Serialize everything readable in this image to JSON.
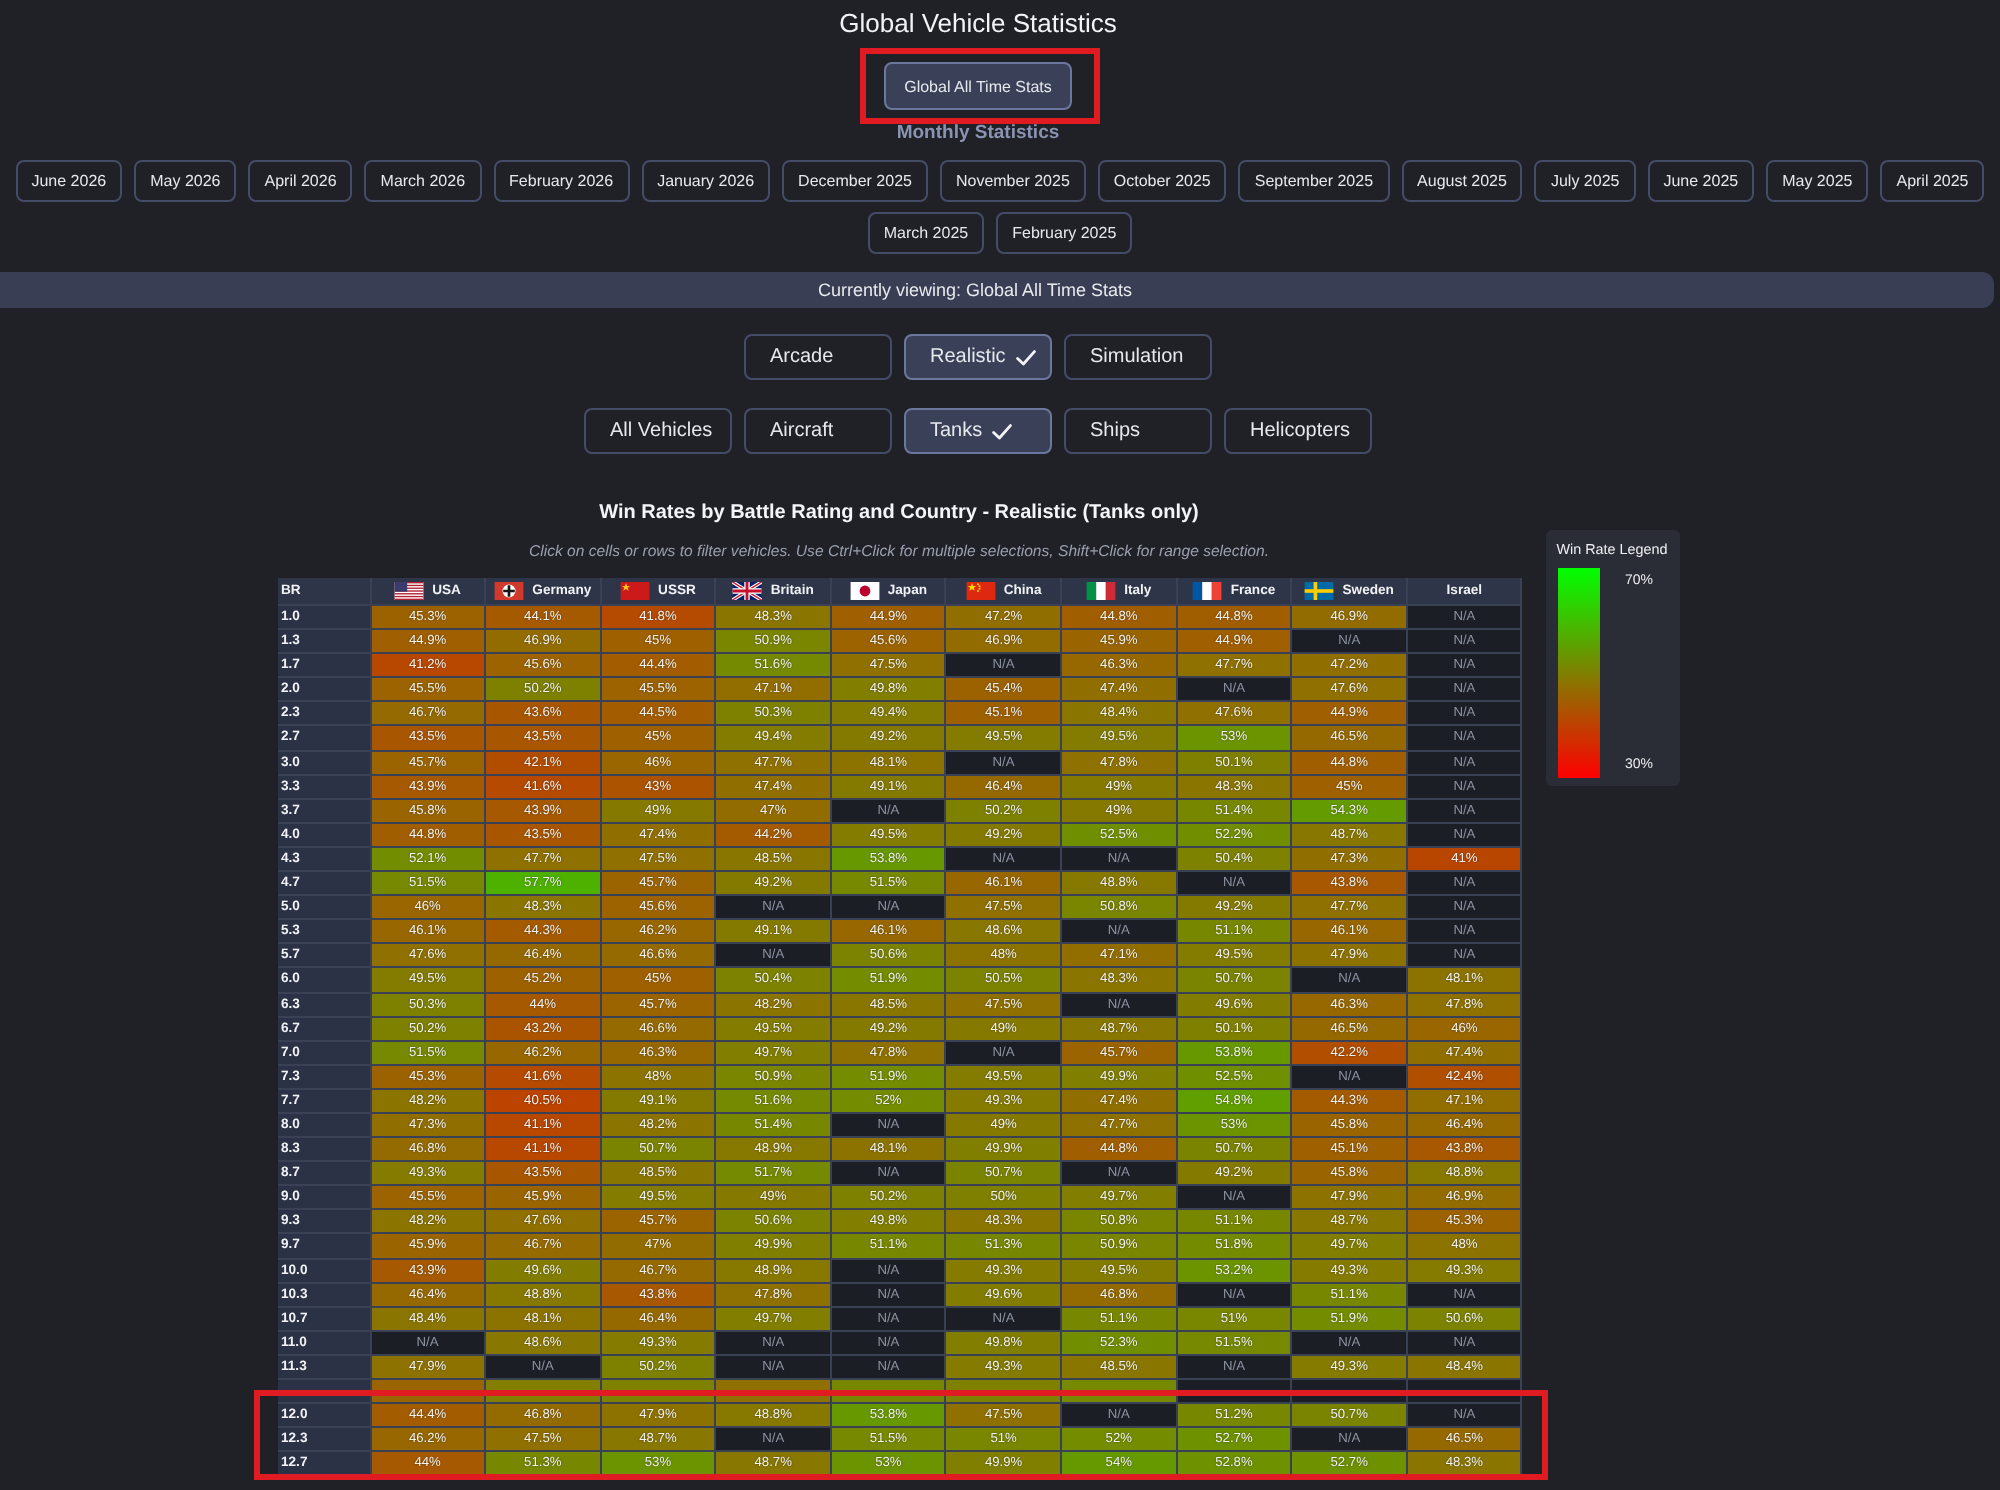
{
  "page": {
    "title": "Global Vehicle Statistics"
  },
  "all_time_button": {
    "label": "Global All Time Stats",
    "selected": true,
    "highlighted": true
  },
  "monthly": {
    "heading": "Monthly Statistics",
    "months": [
      {
        "label": "June 2026",
        "selected": false
      },
      {
        "label": "May 2026",
        "selected": false
      },
      {
        "label": "April 2026",
        "selected": false
      },
      {
        "label": "March 2026",
        "selected": false
      },
      {
        "label": "February 2026",
        "selected": false
      },
      {
        "label": "January 2026",
        "selected": false
      },
      {
        "label": "December 2025",
        "selected": false
      },
      {
        "label": "November 2025",
        "selected": false
      },
      {
        "label": "October 2025",
        "selected": false
      },
      {
        "label": "September 2025",
        "selected": false
      },
      {
        "label": "August 2025",
        "selected": false
      },
      {
        "label": "July 2025",
        "selected": false
      },
      {
        "label": "June 2025",
        "selected": false
      },
      {
        "label": "May 2025",
        "selected": false
      },
      {
        "label": "April 2025",
        "selected": false
      },
      {
        "label": "March 2025",
        "selected": false
      },
      {
        "label": "February 2025",
        "selected": false
      }
    ]
  },
  "status_bar": {
    "text": "Currently viewing: Global All Time Stats"
  },
  "modes": [
    {
      "label": "Arcade",
      "selected": false
    },
    {
      "label": "Realistic",
      "selected": true
    },
    {
      "label": "Simulation",
      "selected": false
    }
  ],
  "categories": [
    {
      "label": "All Vehicles",
      "selected": false
    },
    {
      "label": "Aircraft",
      "selected": false
    },
    {
      "label": "Tanks",
      "selected": true
    },
    {
      "label": "Ships",
      "selected": false
    },
    {
      "label": "Helicopters",
      "selected": false
    }
  ],
  "heatmap": {
    "title": "Win Rates by Battle Rating and Country - Realistic (Tanks only)",
    "hint": "Click on cells or rows to filter vehicles. Use Ctrl+Click for multiple selections, Shift+Click for range selection.",
    "corner_label": "BR",
    "columns": [
      {
        "label": "USA",
        "kind": "us"
      },
      {
        "label": "Germany",
        "kind": "germany"
      },
      {
        "label": "USSR",
        "kind": "ussr"
      },
      {
        "label": "Britain",
        "kind": "uk"
      },
      {
        "label": "Japan",
        "kind": "japan"
      },
      {
        "label": "China",
        "kind": "china"
      },
      {
        "label": "Italy",
        "kind": "italy"
      },
      {
        "label": "France",
        "kind": "france"
      },
      {
        "label": "Sweden",
        "kind": "sweden"
      },
      {
        "label": "Israel",
        "kind": "plain"
      }
    ],
    "rows": [
      {
        "br": "1.0",
        "highlighted": false,
        "cells": [
          {
            "value": "45.3%",
            "color": "#9d6200"
          },
          {
            "value": "44.1%",
            "color": "#a55a00"
          },
          {
            "value": "41.8%",
            "color": "#b44b00"
          },
          {
            "value": "48.3%",
            "color": "#8a7500"
          },
          {
            "value": "44.9%",
            "color": "#a05f00"
          },
          {
            "value": "47.2%",
            "color": "#916e00"
          },
          {
            "value": "44.8%",
            "color": "#a15e00"
          },
          {
            "value": "44.8%",
            "color": "#a15e00"
          },
          {
            "value": "46.9%",
            "color": "#936c00"
          },
          {
            "value": "N/A"
          }
        ]
      },
      {
        "br": "1.3",
        "highlighted": false,
        "cells": [
          {
            "value": "44.9%",
            "color": "#a05f00"
          },
          {
            "value": "46.9%",
            "color": "#936c00"
          },
          {
            "value": "45%",
            "color": "#9f6000"
          },
          {
            "value": "50.9%",
            "color": "#7a8500"
          },
          {
            "value": "45.6%",
            "color": "#9c6300"
          },
          {
            "value": "46.9%",
            "color": "#936c00"
          },
          {
            "value": "45.9%",
            "color": "#9a6500"
          },
          {
            "value": "44.9%",
            "color": "#a05f00"
          },
          {
            "value": "N/A"
          },
          {
            "value": "N/A"
          }
        ]
      },
      {
        "br": "1.7",
        "highlighted": false,
        "cells": [
          {
            "value": "41.2%",
            "color": "#b84700"
          },
          {
            "value": "45.6%",
            "color": "#9c6300"
          },
          {
            "value": "44.4%",
            "color": "#a35c00"
          },
          {
            "value": "51.6%",
            "color": "#758a00"
          },
          {
            "value": "47.5%",
            "color": "#8f7000"
          },
          {
            "value": "N/A"
          },
          {
            "value": "46.3%",
            "color": "#976800"
          },
          {
            "value": "47.7%",
            "color": "#8e7100"
          },
          {
            "value": "47.2%",
            "color": "#916e00"
          },
          {
            "value": "N/A"
          }
        ]
      },
      {
        "br": "2.0",
        "highlighted": false,
        "cells": [
          {
            "value": "45.5%",
            "color": "#9c6300"
          },
          {
            "value": "50.2%",
            "color": "#7e8100"
          },
          {
            "value": "45.5%",
            "color": "#9c6300"
          },
          {
            "value": "47.1%",
            "color": "#926d00"
          },
          {
            "value": "49.8%",
            "color": "#817e00"
          },
          {
            "value": "45.4%",
            "color": "#9d6200"
          },
          {
            "value": "47.4%",
            "color": "#906f00"
          },
          {
            "value": "N/A"
          },
          {
            "value": "47.6%",
            "color": "#8f7000"
          },
          {
            "value": "N/A"
          }
        ]
      },
      {
        "br": "2.3",
        "highlighted": false,
        "cells": [
          {
            "value": "46.7%",
            "color": "#956a00"
          },
          {
            "value": "43.6%",
            "color": "#a85700"
          },
          {
            "value": "44.5%",
            "color": "#a35c00"
          },
          {
            "value": "50.3%",
            "color": "#7e8100"
          },
          {
            "value": "49.4%",
            "color": "#837c00"
          },
          {
            "value": "45.1%",
            "color": "#9f6000"
          },
          {
            "value": "48.4%",
            "color": "#8a7500"
          },
          {
            "value": "47.6%",
            "color": "#8f7000"
          },
          {
            "value": "44.9%",
            "color": "#a05f00"
          },
          {
            "value": "N/A"
          }
        ]
      },
      {
        "br": "2.7",
        "highlighted": false,
        "cells": [
          {
            "value": "43.5%",
            "color": "#a95600"
          },
          {
            "value": "43.5%",
            "color": "#a95600"
          },
          {
            "value": "45%",
            "color": "#9f6000"
          },
          {
            "value": "49.4%",
            "color": "#837c00"
          },
          {
            "value": "49.2%",
            "color": "#857a00"
          },
          {
            "value": "49.5%",
            "color": "#837c00"
          },
          {
            "value": "49.5%",
            "color": "#837c00"
          },
          {
            "value": "53%",
            "color": "#6c9300"
          },
          {
            "value": "46.5%",
            "color": "#966900"
          },
          {
            "value": "N/A"
          }
        ]
      },
      {
        "br": "3.0",
        "highlighted": false,
        "cells": [
          {
            "value": "45.7%",
            "color": "#9b6400"
          },
          {
            "value": "42.1%",
            "color": "#b24d00"
          },
          {
            "value": "46%",
            "color": "#996600"
          },
          {
            "value": "47.7%",
            "color": "#8e7100"
          },
          {
            "value": "48.1%",
            "color": "#8c7300"
          },
          {
            "value": "N/A"
          },
          {
            "value": "47.8%",
            "color": "#8e7100"
          },
          {
            "value": "50.1%",
            "color": "#7f8000"
          },
          {
            "value": "44.8%",
            "color": "#a15e00"
          },
          {
            "value": "N/A"
          }
        ]
      },
      {
        "br": "3.3",
        "highlighted": false,
        "cells": [
          {
            "value": "43.9%",
            "color": "#a65900"
          },
          {
            "value": "41.6%",
            "color": "#b54a00"
          },
          {
            "value": "43%",
            "color": "#ac5300"
          },
          {
            "value": "47.4%",
            "color": "#906f00"
          },
          {
            "value": "49.1%",
            "color": "#857a00"
          },
          {
            "value": "46.4%",
            "color": "#966900"
          },
          {
            "value": "49%",
            "color": "#867900"
          },
          {
            "value": "48.3%",
            "color": "#8a7500"
          },
          {
            "value": "45%",
            "color": "#9f6000"
          },
          {
            "value": "N/A"
          }
        ]
      },
      {
        "br": "3.7",
        "highlighted": false,
        "cells": [
          {
            "value": "45.8%",
            "color": "#9a6500"
          },
          {
            "value": "43.9%",
            "color": "#a65900"
          },
          {
            "value": "49%",
            "color": "#867900"
          },
          {
            "value": "47%",
            "color": "#936c00"
          },
          {
            "value": "N/A"
          },
          {
            "value": "50.2%",
            "color": "#7e8100"
          },
          {
            "value": "49%",
            "color": "#867900"
          },
          {
            "value": "51.4%",
            "color": "#778800"
          },
          {
            "value": "54.3%",
            "color": "#649b00"
          },
          {
            "value": "N/A"
          }
        ]
      },
      {
        "br": "4.0",
        "highlighted": false,
        "cells": [
          {
            "value": "44.8%",
            "color": "#a15e00"
          },
          {
            "value": "43.5%",
            "color": "#a95600"
          },
          {
            "value": "47.4%",
            "color": "#906f00"
          },
          {
            "value": "44.2%",
            "color": "#a45b00"
          },
          {
            "value": "49.5%",
            "color": "#837c00"
          },
          {
            "value": "49.2%",
            "color": "#857a00"
          },
          {
            "value": "52.5%",
            "color": "#708f00"
          },
          {
            "value": "52.2%",
            "color": "#718e00"
          },
          {
            "value": "48.7%",
            "color": "#887700"
          },
          {
            "value": "N/A"
          }
        ]
      },
      {
        "br": "4.3",
        "highlighted": false,
        "cells": [
          {
            "value": "52.1%",
            "color": "#728d00"
          },
          {
            "value": "47.7%",
            "color": "#8e7100"
          },
          {
            "value": "47.5%",
            "color": "#8f7000"
          },
          {
            "value": "48.5%",
            "color": "#897600"
          },
          {
            "value": "53.8%",
            "color": "#679800"
          },
          {
            "value": "N/A"
          },
          {
            "value": "N/A"
          },
          {
            "value": "50.4%",
            "color": "#7d8200"
          },
          {
            "value": "47.3%",
            "color": "#916e00"
          },
          {
            "value": "41%",
            "color": "#b94600"
          }
        ]
      },
      {
        "br": "4.7",
        "highlighted": false,
        "cells": [
          {
            "value": "51.5%",
            "color": "#768900"
          },
          {
            "value": "57.7%",
            "color": "#4eb100"
          },
          {
            "value": "45.7%",
            "color": "#9b6400"
          },
          {
            "value": "49.2%",
            "color": "#857a00"
          },
          {
            "value": "51.5%",
            "color": "#768900"
          },
          {
            "value": "46.1%",
            "color": "#986700"
          },
          {
            "value": "48.8%",
            "color": "#877800"
          },
          {
            "value": "N/A"
          },
          {
            "value": "43.8%",
            "color": "#a75800"
          },
          {
            "value": "N/A"
          }
        ]
      },
      {
        "br": "5.0",
        "highlighted": false,
        "cells": [
          {
            "value": "46%",
            "color": "#996600"
          },
          {
            "value": "48.3%",
            "color": "#8a7500"
          },
          {
            "value": "45.6%",
            "color": "#9c6300"
          },
          {
            "value": "N/A"
          },
          {
            "value": "N/A"
          },
          {
            "value": "47.5%",
            "color": "#8f7000"
          },
          {
            "value": "50.8%",
            "color": "#7a8500"
          },
          {
            "value": "49.2%",
            "color": "#857a00"
          },
          {
            "value": "47.7%",
            "color": "#8e7100"
          },
          {
            "value": "N/A"
          }
        ]
      },
      {
        "br": "5.3",
        "highlighted": false,
        "cells": [
          {
            "value": "46.1%",
            "color": "#986700"
          },
          {
            "value": "44.3%",
            "color": "#a45b00"
          },
          {
            "value": "46.2%",
            "color": "#986700"
          },
          {
            "value": "49.1%",
            "color": "#857a00"
          },
          {
            "value": "46.1%",
            "color": "#986700"
          },
          {
            "value": "48.6%",
            "color": "#887700"
          },
          {
            "value": "N/A"
          },
          {
            "value": "51.1%",
            "color": "#788700"
          },
          {
            "value": "46.1%",
            "color": "#986700"
          },
          {
            "value": "N/A"
          }
        ]
      },
      {
        "br": "5.7",
        "highlighted": false,
        "cells": [
          {
            "value": "47.6%",
            "color": "#8f7000"
          },
          {
            "value": "46.4%",
            "color": "#966900"
          },
          {
            "value": "46.6%",
            "color": "#956a00"
          },
          {
            "value": "N/A"
          },
          {
            "value": "50.6%",
            "color": "#7c8300"
          },
          {
            "value": "48%",
            "color": "#8c7300"
          },
          {
            "value": "47.1%",
            "color": "#926d00"
          },
          {
            "value": "49.5%",
            "color": "#837c00"
          },
          {
            "value": "47.9%",
            "color": "#8d7200"
          },
          {
            "value": "N/A"
          }
        ]
      },
      {
        "br": "6.0",
        "highlighted": false,
        "cells": [
          {
            "value": "49.5%",
            "color": "#837c00"
          },
          {
            "value": "45.2%",
            "color": "#9e6100"
          },
          {
            "value": "45%",
            "color": "#9f6000"
          },
          {
            "value": "50.4%",
            "color": "#7d8200"
          },
          {
            "value": "51.9%",
            "color": "#738c00"
          },
          {
            "value": "50.5%",
            "color": "#7c8300"
          },
          {
            "value": "48.3%",
            "color": "#8a7500"
          },
          {
            "value": "50.7%",
            "color": "#7b8400"
          },
          {
            "value": "N/A"
          },
          {
            "value": "48.1%",
            "color": "#8c7300"
          }
        ]
      },
      {
        "br": "6.3",
        "highlighted": false,
        "cells": [
          {
            "value": "50.3%",
            "color": "#7e8100"
          },
          {
            "value": "44%",
            "color": "#a65900"
          },
          {
            "value": "45.7%",
            "color": "#9b6400"
          },
          {
            "value": "48.2%",
            "color": "#8b7400"
          },
          {
            "value": "48.5%",
            "color": "#897600"
          },
          {
            "value": "47.5%",
            "color": "#8f7000"
          },
          {
            "value": "N/A"
          },
          {
            "value": "49.6%",
            "color": "#827d00"
          },
          {
            "value": "46.3%",
            "color": "#976800"
          },
          {
            "value": "47.8%",
            "color": "#8e7100"
          }
        ]
      },
      {
        "br": "6.7",
        "highlighted": false,
        "cells": [
          {
            "value": "50.2%",
            "color": "#7e8100"
          },
          {
            "value": "43.2%",
            "color": "#ab5400"
          },
          {
            "value": "46.6%",
            "color": "#956a00"
          },
          {
            "value": "49.5%",
            "color": "#837c00"
          },
          {
            "value": "49.2%",
            "color": "#857a00"
          },
          {
            "value": "49%",
            "color": "#867900"
          },
          {
            "value": "48.7%",
            "color": "#887700"
          },
          {
            "value": "50.1%",
            "color": "#7f8000"
          },
          {
            "value": "46.5%",
            "color": "#966900"
          },
          {
            "value": "46%",
            "color": "#996600"
          }
        ]
      },
      {
        "br": "7.0",
        "highlighted": false,
        "cells": [
          {
            "value": "51.5%",
            "color": "#768900"
          },
          {
            "value": "46.2%",
            "color": "#986700"
          },
          {
            "value": "46.3%",
            "color": "#976800"
          },
          {
            "value": "49.7%",
            "color": "#817e00"
          },
          {
            "value": "47.8%",
            "color": "#8e7100"
          },
          {
            "value": "N/A"
          },
          {
            "value": "45.7%",
            "color": "#9b6400"
          },
          {
            "value": "53.8%",
            "color": "#679800"
          },
          {
            "value": "42.2%",
            "color": "#b14e00"
          },
          {
            "value": "47.4%",
            "color": "#906f00"
          }
        ]
      },
      {
        "br": "7.3",
        "highlighted": false,
        "cells": [
          {
            "value": "45.3%",
            "color": "#9d6200"
          },
          {
            "value": "41.6%",
            "color": "#b54a00"
          },
          {
            "value": "48%",
            "color": "#8c7300"
          },
          {
            "value": "50.9%",
            "color": "#7a8500"
          },
          {
            "value": "51.9%",
            "color": "#738c00"
          },
          {
            "value": "49.5%",
            "color": "#837c00"
          },
          {
            "value": "49.9%",
            "color": "#807f00"
          },
          {
            "value": "52.5%",
            "color": "#708f00"
          },
          {
            "value": "N/A"
          },
          {
            "value": "42.4%",
            "color": "#b04f00"
          }
        ]
      },
      {
        "br": "7.7",
        "highlighted": false,
        "cells": [
          {
            "value": "48.2%",
            "color": "#8b7400"
          },
          {
            "value": "40.5%",
            "color": "#bc4300"
          },
          {
            "value": "49.1%",
            "color": "#857a00"
          },
          {
            "value": "51.6%",
            "color": "#758a00"
          },
          {
            "value": "52%",
            "color": "#738c00"
          },
          {
            "value": "49.3%",
            "color": "#847b00"
          },
          {
            "value": "47.4%",
            "color": "#906f00"
          },
          {
            "value": "54.8%",
            "color": "#619e00"
          },
          {
            "value": "44.3%",
            "color": "#a45b00"
          },
          {
            "value": "47.1%",
            "color": "#926d00"
          }
        ]
      },
      {
        "br": "8.0",
        "highlighted": false,
        "cells": [
          {
            "value": "47.3%",
            "color": "#916e00"
          },
          {
            "value": "41.1%",
            "color": "#b84700"
          },
          {
            "value": "48.2%",
            "color": "#8b7400"
          },
          {
            "value": "51.4%",
            "color": "#778800"
          },
          {
            "value": "N/A"
          },
          {
            "value": "49%",
            "color": "#867900"
          },
          {
            "value": "47.7%",
            "color": "#8e7100"
          },
          {
            "value": "53%",
            "color": "#6c9300"
          },
          {
            "value": "45.8%",
            "color": "#9a6500"
          },
          {
            "value": "46.4%",
            "color": "#966900"
          }
        ]
      },
      {
        "br": "8.3",
        "highlighted": false,
        "cells": [
          {
            "value": "46.8%",
            "color": "#946b00"
          },
          {
            "value": "41.1%",
            "color": "#b84700"
          },
          {
            "value": "50.7%",
            "color": "#7b8400"
          },
          {
            "value": "48.9%",
            "color": "#877800"
          },
          {
            "value": "48.1%",
            "color": "#8c7300"
          },
          {
            "value": "49.9%",
            "color": "#807f00"
          },
          {
            "value": "44.8%",
            "color": "#a15e00"
          },
          {
            "value": "50.7%",
            "color": "#7b8400"
          },
          {
            "value": "45.1%",
            "color": "#9f6000"
          },
          {
            "value": "43.8%",
            "color": "#a75800"
          }
        ]
      },
      {
        "br": "8.7",
        "highlighted": false,
        "cells": [
          {
            "value": "49.3%",
            "color": "#847b00"
          },
          {
            "value": "43.5%",
            "color": "#a95600"
          },
          {
            "value": "48.5%",
            "color": "#897600"
          },
          {
            "value": "51.7%",
            "color": "#758a00"
          },
          {
            "value": "N/A"
          },
          {
            "value": "50.7%",
            "color": "#7b8400"
          },
          {
            "value": "N/A"
          },
          {
            "value": "49.2%",
            "color": "#857a00"
          },
          {
            "value": "45.8%",
            "color": "#9a6500"
          },
          {
            "value": "48.8%",
            "color": "#877800"
          }
        ]
      },
      {
        "br": "9.0",
        "highlighted": false,
        "cells": [
          {
            "value": "45.5%",
            "color": "#9c6300"
          },
          {
            "value": "45.9%",
            "color": "#9a6500"
          },
          {
            "value": "49.5%",
            "color": "#837c00"
          },
          {
            "value": "49%",
            "color": "#867900"
          },
          {
            "value": "50.2%",
            "color": "#7e8100"
          },
          {
            "value": "50%",
            "color": "#7f8000"
          },
          {
            "value": "49.7%",
            "color": "#817e00"
          },
          {
            "value": "N/A"
          },
          {
            "value": "47.9%",
            "color": "#8d7200"
          },
          {
            "value": "46.9%",
            "color": "#936c00"
          }
        ]
      },
      {
        "br": "9.3",
        "highlighted": false,
        "cells": [
          {
            "value": "48.2%",
            "color": "#8b7400"
          },
          {
            "value": "47.6%",
            "color": "#8f7000"
          },
          {
            "value": "45.7%",
            "color": "#9b6400"
          },
          {
            "value": "50.6%",
            "color": "#7c8300"
          },
          {
            "value": "49.8%",
            "color": "#817e00"
          },
          {
            "value": "48.3%",
            "color": "#8a7500"
          },
          {
            "value": "50.8%",
            "color": "#7a8500"
          },
          {
            "value": "51.1%",
            "color": "#788700"
          },
          {
            "value": "48.7%",
            "color": "#887700"
          },
          {
            "value": "45.3%",
            "color": "#9d6200"
          }
        ]
      },
      {
        "br": "9.7",
        "highlighted": false,
        "cells": [
          {
            "value": "45.9%",
            "color": "#9a6500"
          },
          {
            "value": "46.7%",
            "color": "#956a00"
          },
          {
            "value": "47%",
            "color": "#936c00"
          },
          {
            "value": "49.9%",
            "color": "#807f00"
          },
          {
            "value": "51.1%",
            "color": "#788700"
          },
          {
            "value": "51.3%",
            "color": "#778800"
          },
          {
            "value": "50.9%",
            "color": "#7a8500"
          },
          {
            "value": "51.8%",
            "color": "#748b00"
          },
          {
            "value": "49.7%",
            "color": "#817e00"
          },
          {
            "value": "48%",
            "color": "#8c7300"
          }
        ]
      },
      {
        "br": "10.0",
        "highlighted": false,
        "cells": [
          {
            "value": "43.9%",
            "color": "#a65900"
          },
          {
            "value": "49.6%",
            "color": "#827d00"
          },
          {
            "value": "46.7%",
            "color": "#956a00"
          },
          {
            "value": "48.9%",
            "color": "#877800"
          },
          {
            "value": "N/A"
          },
          {
            "value": "49.3%",
            "color": "#847b00"
          },
          {
            "value": "49.5%",
            "color": "#837c00"
          },
          {
            "value": "53.2%",
            "color": "#6b9400"
          },
          {
            "value": "49.3%",
            "color": "#847b00"
          },
          {
            "value": "49.3%",
            "color": "#847b00"
          }
        ]
      },
      {
        "br": "10.3",
        "highlighted": false,
        "cells": [
          {
            "value": "46.4%",
            "color": "#966900"
          },
          {
            "value": "48.8%",
            "color": "#877800"
          },
          {
            "value": "43.8%",
            "color": "#a75800"
          },
          {
            "value": "47.8%",
            "color": "#8e7100"
          },
          {
            "value": "N/A"
          },
          {
            "value": "49.6%",
            "color": "#827d00"
          },
          {
            "value": "46.8%",
            "color": "#946b00"
          },
          {
            "value": "N/A"
          },
          {
            "value": "51.1%",
            "color": "#788700"
          },
          {
            "value": "N/A"
          }
        ]
      },
      {
        "br": "10.7",
        "highlighted": false,
        "cells": [
          {
            "value": "48.4%",
            "color": "#8a7500"
          },
          {
            "value": "48.1%",
            "color": "#8c7300"
          },
          {
            "value": "46.4%",
            "color": "#966900"
          },
          {
            "value": "49.7%",
            "color": "#817e00"
          },
          {
            "value": "N/A"
          },
          {
            "value": "N/A"
          },
          {
            "value": "51.1%",
            "color": "#788700"
          },
          {
            "value": "51%",
            "color": "#798600"
          },
          {
            "value": "51.9%",
            "color": "#738c00"
          },
          {
            "value": "50.6%",
            "color": "#7c8300"
          }
        ]
      },
      {
        "br": "11.0",
        "highlighted": false,
        "cells": [
          {
            "value": "N/A"
          },
          {
            "value": "48.6%",
            "color": "#887700"
          },
          {
            "value": "49.3%",
            "color": "#847b00"
          },
          {
            "value": "N/A"
          },
          {
            "value": "N/A"
          },
          {
            "value": "49.8%",
            "color": "#817e00"
          },
          {
            "value": "52.3%",
            "color": "#718e00"
          },
          {
            "value": "51.5%",
            "color": "#768900"
          },
          {
            "value": "N/A"
          },
          {
            "value": "N/A"
          }
        ]
      },
      {
        "br": "11.3",
        "highlighted": false,
        "cells": [
          {
            "value": "47.9%",
            "color": "#8d7200"
          },
          {
            "value": "N/A"
          },
          {
            "value": "50.2%",
            "color": "#7e8100"
          },
          {
            "value": "N/A"
          },
          {
            "value": "N/A"
          },
          {
            "value": "49.3%",
            "color": "#847b00"
          },
          {
            "value": "48.5%",
            "color": "#897600"
          },
          {
            "value": "N/A"
          },
          {
            "value": "49.3%",
            "color": "#847b00"
          },
          {
            "value": "48.4%",
            "color": "#8a7500"
          }
        ]
      },
      {
        "highlighted": false,
        "cells": [
          {
            "color": "#9a6500"
          },
          {
            "color": "#817e00"
          },
          {
            "color": "#7e8100"
          },
          {
            "color": "#8f7000"
          },
          {
            "color": "#788700"
          },
          {
            "color": "#7e8100"
          },
          {
            "color": "#758a00"
          },
          {
            "color": "#1b1e24"
          },
          {
            "color": "#1b1e24"
          },
          {
            "color": "#1b1e24"
          }
        ]
      },
      {
        "br": "12.0",
        "highlighted": true,
        "cells": [
          {
            "value": "44.4%",
            "color": "#a35c00"
          },
          {
            "value": "46.8%",
            "color": "#946b00"
          },
          {
            "value": "47.9%",
            "color": "#8d7200"
          },
          {
            "value": "48.8%",
            "color": "#877800"
          },
          {
            "value": "53.8%",
            "color": "#679800"
          },
          {
            "value": "47.5%",
            "color": "#8f7000"
          },
          {
            "value": "N/A"
          },
          {
            "value": "51.2%",
            "color": "#788700"
          },
          {
            "value": "50.7%",
            "color": "#7b8400"
          },
          {
            "value": "N/A"
          }
        ]
      },
      {
        "br": "12.3",
        "highlighted": true,
        "cells": [
          {
            "value": "46.2%",
            "color": "#986700"
          },
          {
            "value": "47.5%",
            "color": "#8f7000"
          },
          {
            "value": "48.7%",
            "color": "#887700"
          },
          {
            "value": "N/A"
          },
          {
            "value": "51.5%",
            "color": "#768900"
          },
          {
            "value": "51%",
            "color": "#798600"
          },
          {
            "value": "52%",
            "color": "#738c00"
          },
          {
            "value": "52.7%",
            "color": "#6e9100"
          },
          {
            "value": "N/A"
          },
          {
            "value": "46.5%",
            "color": "#966900"
          }
        ]
      },
      {
        "br": "12.7",
        "highlighted": true,
        "cells": [
          {
            "value": "44%",
            "color": "#a65900"
          },
          {
            "value": "51.3%",
            "color": "#778800"
          },
          {
            "value": "53%",
            "color": "#6c9300"
          },
          {
            "value": "48.7%",
            "color": "#887700"
          },
          {
            "value": "53%",
            "color": "#6c9300"
          },
          {
            "value": "49.9%",
            "color": "#807f00"
          },
          {
            "value": "54%",
            "color": "#669900"
          },
          {
            "value": "52.8%",
            "color": "#6e9100"
          },
          {
            "value": "52.7%",
            "color": "#6e9100"
          },
          {
            "value": "48.3%",
            "color": "#8a7500"
          }
        ]
      }
    ]
  },
  "legend": {
    "title": "Win Rate Legend",
    "max_label": "70%",
    "min_label": "30%"
  }
}
